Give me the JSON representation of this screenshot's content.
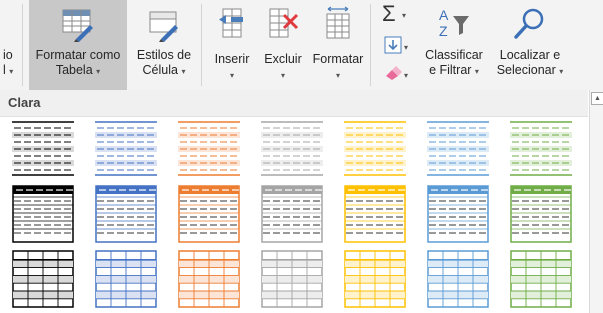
{
  "ribbon": {
    "partial_left": {
      "line1": "io",
      "line2": "l"
    },
    "format_as_table": {
      "line1": "Formatar como",
      "line2": "Tabela"
    },
    "cell_styles": {
      "line1": "Estilos de",
      "line2": "Célula"
    },
    "insert": {
      "label": "Inserir"
    },
    "delete": {
      "label": "Excluir"
    },
    "format": {
      "label": "Formatar"
    },
    "sort_filter": {
      "line1": "Classificar",
      "line2": "e Filtrar"
    },
    "find_select": {
      "line1": "Localizar e",
      "line2": "Selecionar"
    },
    "autosum_glyph": "Σ",
    "caret": "▾"
  },
  "gallery": {
    "section_label": "Clara",
    "scroll_up_glyph": "▲",
    "colors": [
      "#000000",
      "#4472c4",
      "#ed7d31",
      "#a5a5a5",
      "#ffc000",
      "#5b9bd5",
      "#70ad47"
    ],
    "shades": [
      "#d9d9d9",
      "#d9e1f2",
      "#fce4d6",
      "#ededed",
      "#fff2cc",
      "#ddebf7",
      "#e2efda"
    ],
    "rows": [
      {
        "name": "light-style-banded",
        "styles": [
          "Clara 1",
          "Clara 2",
          "Clara 3",
          "Clara 4",
          "Clara 5",
          "Clara 6",
          "Clara 7"
        ]
      },
      {
        "name": "light-style-header",
        "styles": [
          "Clara 8",
          "Clara 9",
          "Clara 10",
          "Clara 11",
          "Clara 12",
          "Clara 13",
          "Clara 14"
        ]
      },
      {
        "name": "light-style-grid",
        "styles": [
          "Clara 15",
          "Clara 16",
          "Clara 17",
          "Clara 18",
          "Clara 19",
          "Clara 20",
          "Clara 21"
        ]
      }
    ]
  }
}
